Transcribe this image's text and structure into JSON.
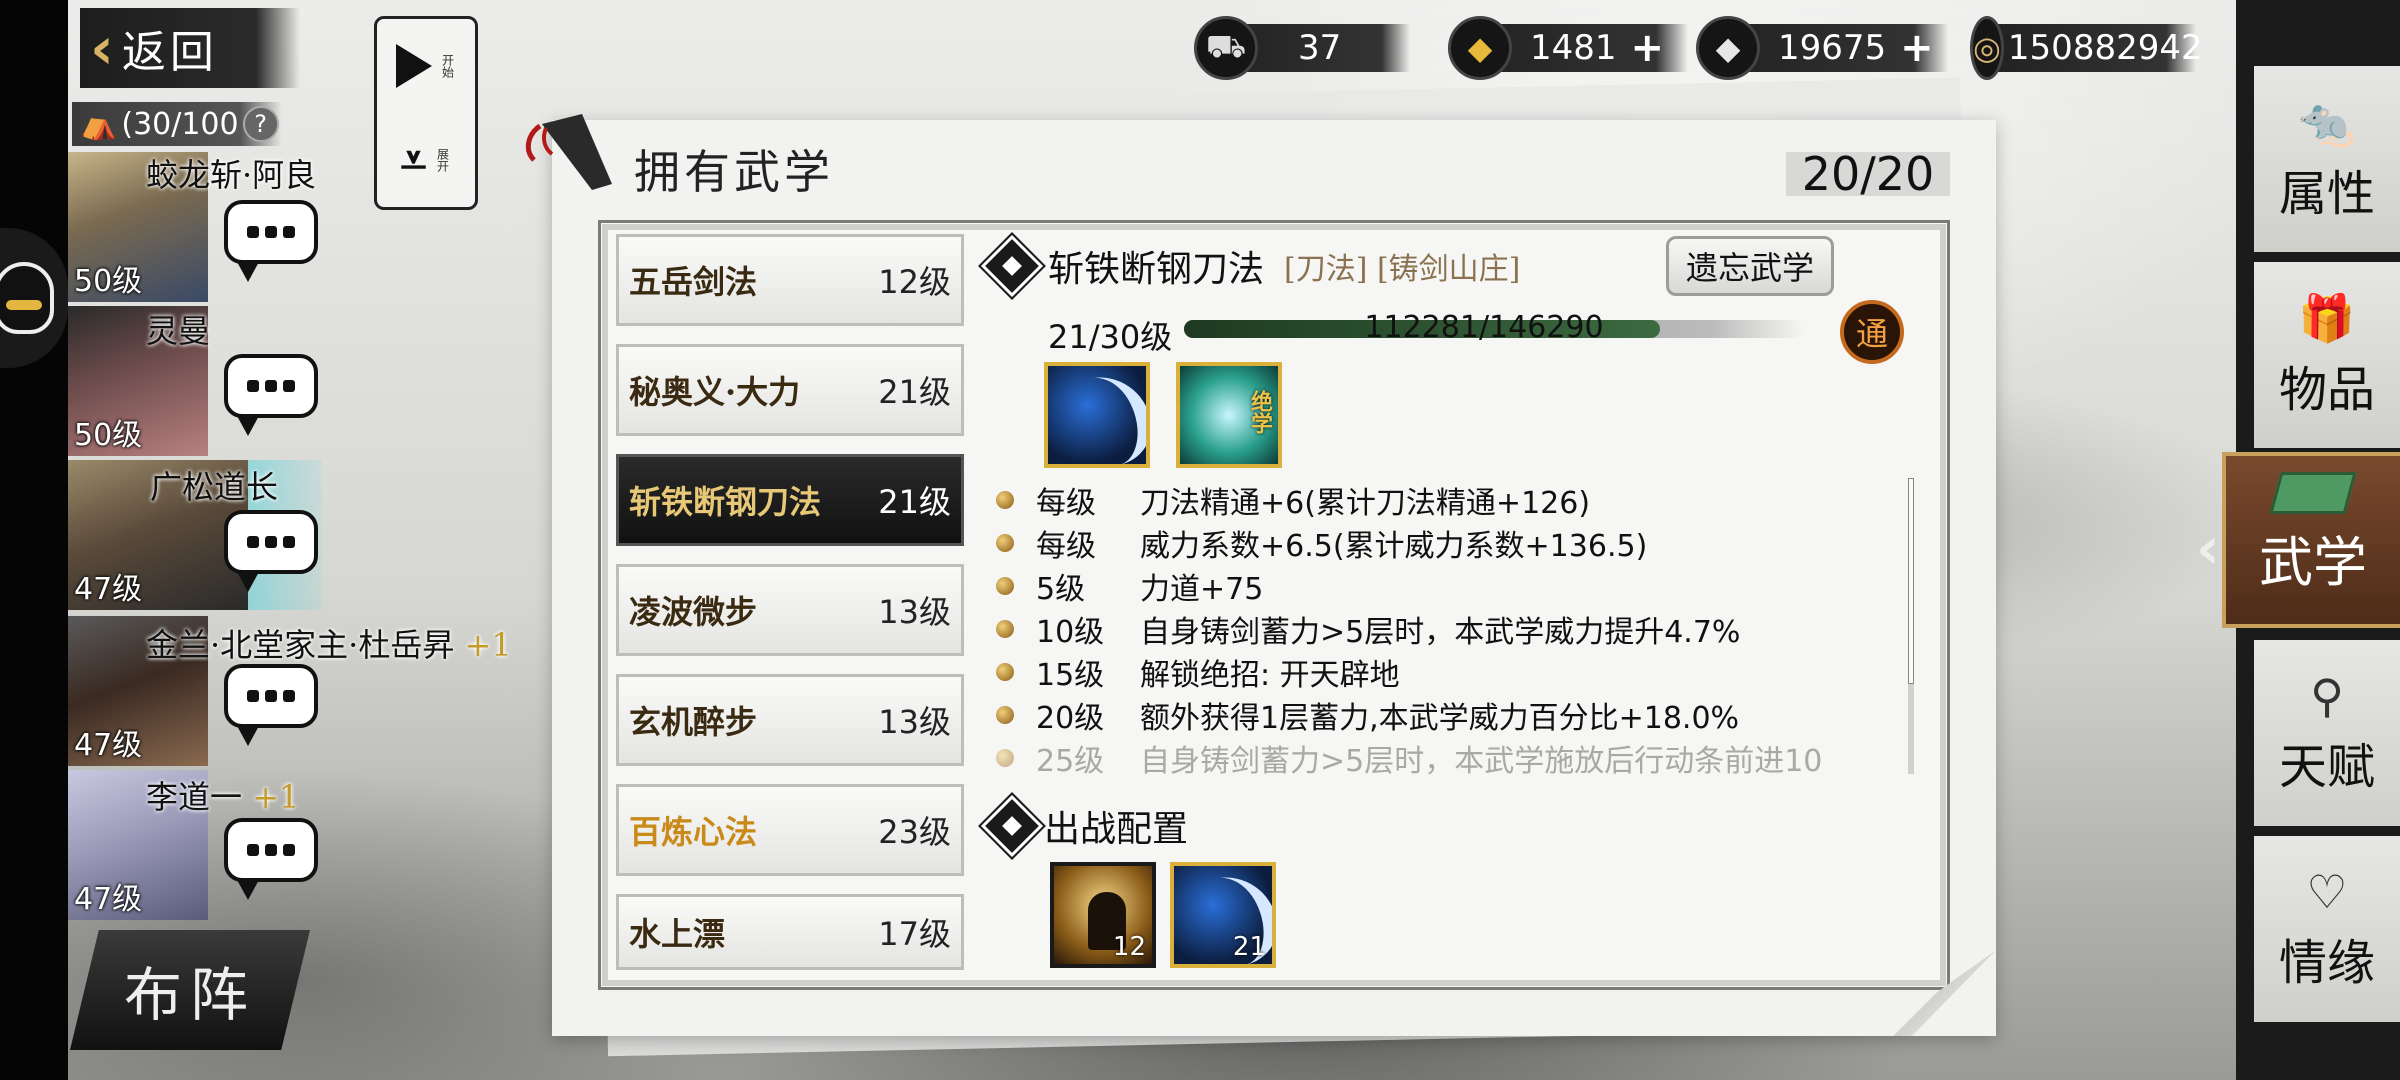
{
  "top_bar": {
    "back_label": "返回",
    "party_count": "(30/100",
    "help_glyph": "?",
    "currencies": [
      {
        "icon": "cart-icon",
        "value": "37"
      },
      {
        "icon": "gold-ingot-icon",
        "value": "1481",
        "plus": "+"
      },
      {
        "icon": "silver-ingot-icon",
        "value": "19675",
        "plus": "+"
      },
      {
        "icon": "coin-icon",
        "value": "150882942"
      }
    ]
  },
  "controls": {
    "start_label": "开始",
    "expand_label": "展开"
  },
  "characters": [
    {
      "name": "蛟龙斩·阿良",
      "plus": "",
      "level": "50级"
    },
    {
      "name": "灵曼",
      "plus": "",
      "level": "50级"
    },
    {
      "name": "广松道长",
      "plus": "",
      "level": "47级"
    },
    {
      "name": "金兰·北堂家主·杜岳昇",
      "plus": "+1",
      "level": "47级"
    },
    {
      "name": "李道一",
      "plus": "+1",
      "level": "47级"
    }
  ],
  "formation_label": "布阵",
  "right_nav": [
    {
      "label": "属性",
      "icon": "rat-icon"
    },
    {
      "label": "物品",
      "icon": "giftbox-icon"
    },
    {
      "label": "武学",
      "icon": "book-icon",
      "active": true
    },
    {
      "label": "天赋",
      "icon": "talent-icon"
    },
    {
      "label": "情缘",
      "icon": "heart-icon"
    }
  ],
  "panel": {
    "title": "拥有武学",
    "capacity": "20/20",
    "skills": [
      {
        "name": "五岳剑法",
        "level": "12级"
      },
      {
        "name": "秘奥义·大力",
        "level": "21级"
      },
      {
        "name": "斩铁断钢刀法",
        "level": "21级",
        "selected": true
      },
      {
        "name": "凌波微步",
        "level": "13级"
      },
      {
        "name": "玄机醉步",
        "level": "13级"
      },
      {
        "name": "百炼心法",
        "level": "23级",
        "highlight": true
      },
      {
        "name": "水上漂",
        "level": "17级"
      }
    ],
    "detail": {
      "name": "斩铁断钢刀法",
      "tags": "[刀法] [铸剑山庄]",
      "forget_label": "遗忘武学",
      "level": "21/30级",
      "xp_text": "112281/146290",
      "xp_fraction": 0.7675,
      "mastery_badge": "通",
      "ultimate_tag": "绝学",
      "effects": [
        {
          "key": "每级",
          "text": "刀法精通+6(累计刀法精通+126)"
        },
        {
          "key": "每级",
          "text": "威力系数+6.5(累计威力系数+136.5)"
        },
        {
          "key": "5级",
          "text": "力道+75"
        },
        {
          "key": "10级",
          "text": "自身铸剑蓄力>5层时，本武学威力提升4.7%"
        },
        {
          "key": "15级",
          "text": "解锁绝招: 开天辟地"
        },
        {
          "key": "20级",
          "text": "额外获得1层蓄力,本武学威力百分比+18.0%"
        },
        {
          "key": "25级",
          "text": "自身铸剑蓄力>5层时，本武学施放后行动条前进10",
          "dim": true
        }
      ],
      "deploy_title": "出战配置",
      "deploy_slots": [
        {
          "level": "12",
          "icon": "meditation-icon"
        },
        {
          "level": "21",
          "icon": "blade-icon"
        }
      ]
    }
  }
}
